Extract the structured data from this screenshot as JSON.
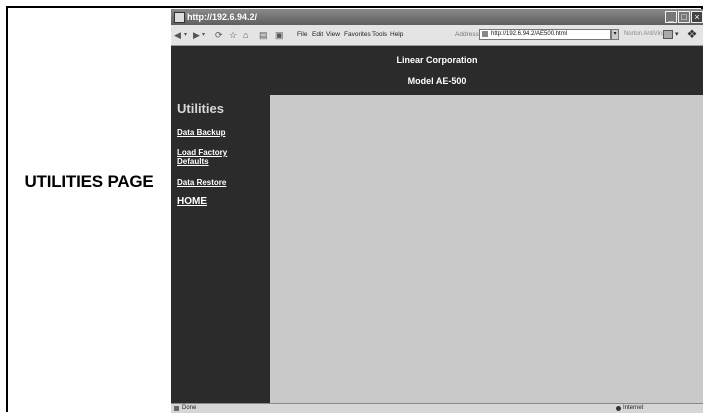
{
  "caption": "UTILITIES PAGE",
  "browser": {
    "title": "http://192.6.94.2/",
    "window_buttons": [
      "_",
      "□",
      "×"
    ],
    "menu": [
      "File",
      "Edit",
      "View",
      "Favorites",
      "Tools",
      "Help"
    ],
    "address_label": "Address",
    "address_value": "http://192.6.94.2/AE500.html",
    "norton_label": "Norton AntiVirus",
    "status_left": "Done",
    "status_zone": "Internet"
  },
  "header": {
    "company": "Linear Corporation",
    "model": "Model AE-500"
  },
  "sidebar": {
    "title": "Utilities",
    "links": {
      "data_backup": "Data Backup",
      "load_factory_line1": "Load Factory",
      "load_factory_line2": "Defaults",
      "data_restore": "Data Restore",
      "home": "HOME"
    }
  }
}
